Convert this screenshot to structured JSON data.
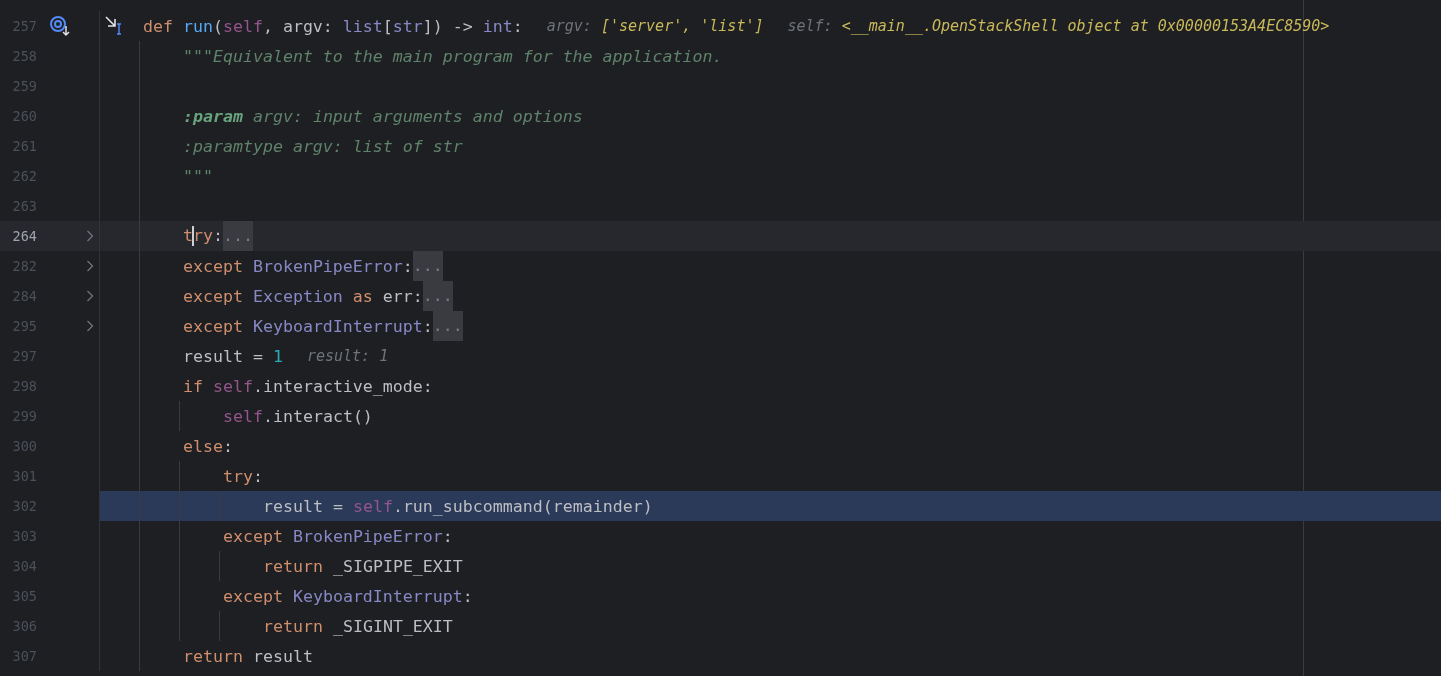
{
  "editor": {
    "lines": [
      {
        "number": "257",
        "current": false,
        "executing": false,
        "folded": false,
        "markers": [
          {
            "kind": "frame"
          },
          {
            "kind": "step"
          }
        ],
        "tokens": [
          {
            "kind": "keyword",
            "text": "def "
          },
          {
            "kind": "func",
            "text": "run"
          },
          {
            "kind": "plain",
            "text": "("
          },
          {
            "kind": "self",
            "text": "self"
          },
          {
            "kind": "plain",
            "text": ", argv: "
          },
          {
            "kind": "type",
            "text": "list"
          },
          {
            "kind": "plain",
            "text": "["
          },
          {
            "kind": "type",
            "text": "str"
          },
          {
            "kind": "plain",
            "text": "]) -> "
          },
          {
            "kind": "type",
            "text": "int"
          },
          {
            "kind": "plain",
            "text": ":"
          }
        ],
        "hints": [
          {
            "label": "argv: ",
            "value": "['server', 'list']"
          },
          {
            "label": "self: ",
            "value": "<__main__.OpenStackShell object at 0x00000153A4EC8590>"
          }
        ],
        "children": [
          {
            "number": "258",
            "current": false,
            "executing": false,
            "folded": false,
            "tokens": [
              {
                "kind": "doc",
                "text": "\"\"\"Equivalent to the main program for the application."
              }
            ]
          },
          {
            "number": "259",
            "current": false,
            "executing": false,
            "folded": false
          },
          {
            "number": "260",
            "current": false,
            "executing": false,
            "folded": false,
            "tokens": [
              {
                "kind": "doctag",
                "text": ":param"
              },
              {
                "kind": "doc",
                "text": " argv: input arguments and options"
              }
            ]
          },
          {
            "number": "261",
            "current": false,
            "executing": false,
            "folded": false,
            "tokens": [
              {
                "kind": "doc",
                "text": ":paramtype argv: list of str"
              }
            ]
          },
          {
            "number": "262",
            "current": false,
            "executing": false,
            "folded": false,
            "tokens": [
              {
                "kind": "doc",
                "text": "\"\"\""
              }
            ]
          },
          {
            "number": "263",
            "current": false,
            "executing": false,
            "folded": false
          },
          {
            "number": "264",
            "current": true,
            "executing": false,
            "folded": true,
            "tokens": [
              {
                "kind": "keyword",
                "text": "t"
              },
              {
                "kind": "caret"
              },
              {
                "kind": "keyword",
                "text": "ry"
              },
              {
                "kind": "plain",
                "text": ":"
              }
            ],
            "placeholder": "..."
          },
          {
            "number": "282",
            "current": false,
            "executing": false,
            "folded": true,
            "tokens": [
              {
                "kind": "keyword",
                "text": "except "
              },
              {
                "kind": "type",
                "text": "BrokenPipeError"
              },
              {
                "kind": "plain",
                "text": ":"
              }
            ],
            "placeholder": "..."
          },
          {
            "number": "284",
            "current": false,
            "executing": false,
            "folded": true,
            "tokens": [
              {
                "kind": "keyword",
                "text": "except "
              },
              {
                "kind": "type",
                "text": "Exception "
              },
              {
                "kind": "keyword",
                "text": "as"
              },
              {
                "kind": "plain",
                "text": " err:"
              }
            ],
            "placeholder": "..."
          },
          {
            "number": "295",
            "current": false,
            "executing": false,
            "folded": true,
            "tokens": [
              {
                "kind": "keyword",
                "text": "except "
              },
              {
                "kind": "type",
                "text": "KeyboardInterrupt"
              },
              {
                "kind": "plain",
                "text": ":"
              }
            ],
            "placeholder": "..."
          },
          {
            "number": "297",
            "current": false,
            "executing": false,
            "folded": false,
            "tokens": [
              {
                "kind": "plain",
                "text": "result = "
              },
              {
                "kind": "number",
                "text": "1"
              }
            ],
            "hints": [
              {
                "label": "result: 1"
              }
            ]
          },
          {
            "number": "298",
            "current": false,
            "executing": false,
            "folded": false,
            "tokens": [
              {
                "kind": "keyword",
                "text": "if "
              },
              {
                "kind": "self",
                "text": "self"
              },
              {
                "kind": "plain",
                "text": ".interactive_mode:"
              }
            ],
            "children": [
              {
                "number": "299",
                "current": false,
                "executing": false,
                "folded": false,
                "tokens": [
                  {
                    "kind": "self",
                    "text": "self"
                  },
                  {
                    "kind": "plain",
                    "text": ".interact()"
                  }
                ]
              }
            ]
          },
          {
            "number": "300",
            "current": false,
            "executing": false,
            "folded": false,
            "tokens": [
              {
                "kind": "keyword",
                "text": "else"
              },
              {
                "kind": "plain",
                "text": ":"
              }
            ],
            "children": [
              {
                "number": "301",
                "current": false,
                "executing": false,
                "folded": false,
                "tokens": [
                  {
                    "kind": "keyword",
                    "text": "try"
                  },
                  {
                    "kind": "plain",
                    "text": ":"
                  }
                ],
                "children": [
                  {
                    "number": "302",
                    "current": false,
                    "executing": true,
                    "folded": false,
                    "tokens": [
                      {
                        "kind": "plain",
                        "text": "result = "
                      },
                      {
                        "kind": "self",
                        "text": "self"
                      },
                      {
                        "kind": "plain",
                        "text": ".run_subcommand(remainder)"
                      }
                    ]
                  }
                ]
              },
              {
                "number": "303",
                "current": false,
                "executing": false,
                "folded": false,
                "tokens": [
                  {
                    "kind": "keyword",
                    "text": "except "
                  },
                  {
                    "kind": "type",
                    "text": "BrokenPipeError"
                  },
                  {
                    "kind": "plain",
                    "text": ":"
                  }
                ],
                "children": [
                  {
                    "number": "304",
                    "current": false,
                    "executing": false,
                    "folded": false,
                    "tokens": [
                      {
                        "kind": "keyword",
                        "text": "return"
                      },
                      {
                        "kind": "plain",
                        "text": " _SIGPIPE_EXIT"
                      }
                    ]
                  }
                ]
              },
              {
                "number": "305",
                "current": false,
                "executing": false,
                "folded": false,
                "tokens": [
                  {
                    "kind": "keyword",
                    "text": "except "
                  },
                  {
                    "kind": "type",
                    "text": "KeyboardInterrupt"
                  },
                  {
                    "kind": "plain",
                    "text": ":"
                  }
                ],
                "children": [
                  {
                    "number": "306",
                    "current": false,
                    "executing": false,
                    "folded": false,
                    "tokens": [
                      {
                        "kind": "keyword",
                        "text": "return"
                      },
                      {
                        "kind": "plain",
                        "text": " _SIGINT_EXIT"
                      }
                    ]
                  }
                ]
              }
            ]
          },
          {
            "number": "307",
            "current": false,
            "executing": false,
            "folded": false,
            "tokens": [
              {
                "kind": "keyword",
                "text": "return"
              },
              {
                "kind": "plain",
                "text": " result"
              }
            ]
          }
        ]
      }
    ]
  }
}
